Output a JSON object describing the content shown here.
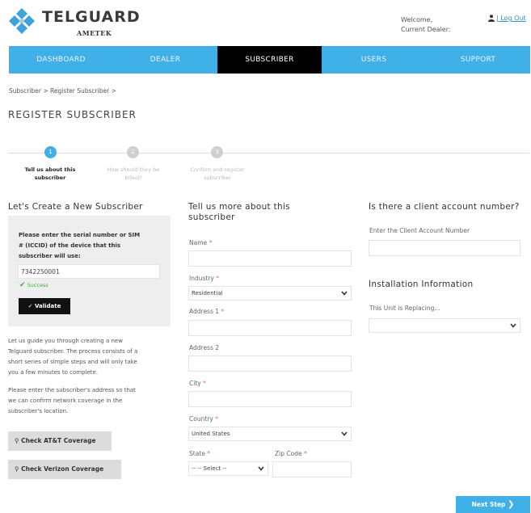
{
  "header": {
    "brand": "TELGUARD",
    "parent_brand": "AMETEK",
    "welcome": "Welcome,",
    "current_dealer": "Current Dealer:",
    "logout": "| Log Out"
  },
  "nav": [
    {
      "label": "DASHBOARD"
    },
    {
      "label": "DEALER"
    },
    {
      "label": "SUBSCRIBER"
    },
    {
      "label": "USERS"
    },
    {
      "label": "SUPPORT"
    }
  ],
  "breadcrumb": "Subscriber > Register Subscriber >",
  "page_title": "REGISTER SUBSCRIBER",
  "steps": [
    {
      "number": "1",
      "line1": "Tell us about this",
      "line2": "subscriber"
    },
    {
      "number": "2",
      "line1": "How should they be",
      "line2": "billed?"
    },
    {
      "number": "3",
      "line1": "Confirm and register",
      "line2": "subscriber"
    }
  ],
  "left": {
    "heading": "Let's Create a New Subscriber",
    "serial_prompt_1": "Please enter the serial number or SIM",
    "serial_prompt_2": "# (ICCID) of the device that this",
    "serial_prompt_3": "subscriber will use:",
    "serial_value": "7342250001",
    "success": "Success",
    "validate": "Validate",
    "guide_1": "Let us guide you through creating a new",
    "guide_2": "Telguard subscriber. The process consists of a",
    "guide_3": "short series of simple steps and will only take",
    "guide_4": "you a few minutes to complete.",
    "address_1": "Please enter the subscriber's address so that",
    "address_2": "we can confirm network coverage in the",
    "address_3": "subscriber's location.",
    "att": "Check AT&T Coverage",
    "verizon": "Check Verizon Coverage"
  },
  "form": {
    "heading_1": "Tell us more about this",
    "heading_2": "subscriber",
    "name": "Name",
    "industry": "Industry",
    "industry_value": "Residential",
    "address1": "Address 1",
    "address2": "Address 2",
    "city": "City",
    "country": "Country",
    "country_value": "United States",
    "state": "State",
    "state_value": "-- -- Select --",
    "zip": "Zip Code",
    "required_mark": "*"
  },
  "right": {
    "client_heading": "Is there a client account number?",
    "client_label": "Enter the Client Account Number",
    "install_heading": "Installation Information",
    "replacing_label": "This Unit is Replacing..."
  },
  "next_step": "Next Step",
  "colors": {
    "accent": "#3fb0e8",
    "nav_active": "#000000",
    "success": "#3cae3c"
  }
}
